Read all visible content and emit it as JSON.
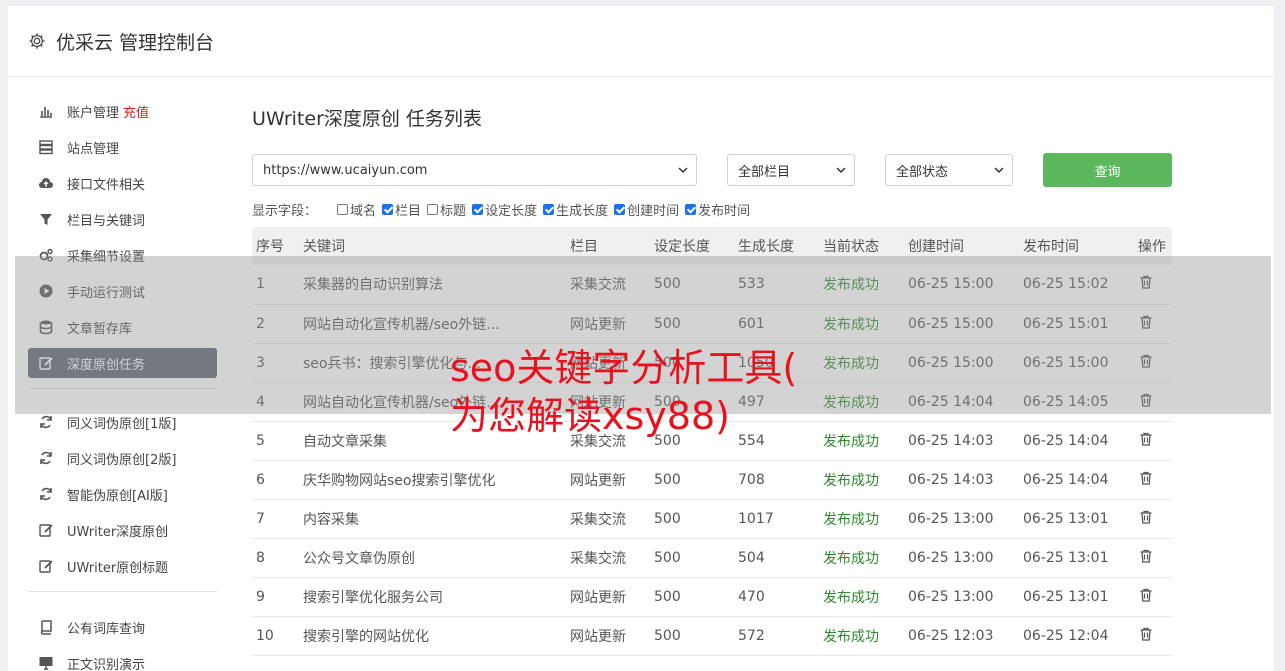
{
  "header": {
    "title": "优采云 管理控制台"
  },
  "sidebar": {
    "group1": [
      {
        "label": "账户管理",
        "accent": "充值",
        "icon": "bar-chart-icon"
      },
      {
        "label": "站点管理",
        "icon": "server-icon"
      },
      {
        "label": "接口文件相关",
        "icon": "cloud-upload-icon"
      },
      {
        "label": "栏目与关键词",
        "icon": "filter-icon"
      },
      {
        "label": "采集细节设置",
        "icon": "gears-icon"
      },
      {
        "label": "手动运行测试",
        "icon": "play-icon"
      },
      {
        "label": "文章暂存库",
        "icon": "database-icon"
      },
      {
        "label": "深度原创任务",
        "icon": "edit-icon",
        "active": true
      }
    ],
    "group2": [
      {
        "label": "同义词伪原创[1版]",
        "icon": "refresh-icon"
      },
      {
        "label": "同义词伪原创[2版]",
        "icon": "refresh-icon"
      },
      {
        "label": "智能伪原创[AI版]",
        "icon": "refresh-icon"
      },
      {
        "label": "UWriter深度原创",
        "icon": "edit-icon"
      },
      {
        "label": "UWriter原创标题",
        "icon": "edit-icon"
      }
    ],
    "group3": [
      {
        "label": "公有词库查询",
        "icon": "book-icon"
      },
      {
        "label": "正文识别演示",
        "icon": "monitor-icon"
      }
    ]
  },
  "main": {
    "title": "UWriter深度原创 任务列表",
    "filters": {
      "site": "https://www.ucaiyun.com",
      "category": "全部栏目",
      "status": "全部状态",
      "query_label": "查询"
    },
    "fields_label": "显示字段：",
    "fields": [
      {
        "label": "域名",
        "checked": false
      },
      {
        "label": "栏目",
        "checked": true
      },
      {
        "label": "标题",
        "checked": false
      },
      {
        "label": "设定长度",
        "checked": true
      },
      {
        "label": "生成长度",
        "checked": true
      },
      {
        "label": "创建时间",
        "checked": true
      },
      {
        "label": "发布时间",
        "checked": true
      }
    ],
    "table": {
      "headers": [
        "序号",
        "关键词",
        "栏目",
        "设定长度",
        "生成长度",
        "当前状态",
        "创建时间",
        "发布时间",
        "操作"
      ],
      "rows": [
        {
          "no": "1",
          "keyword": "采集器的自动识别算法",
          "category": "采集交流",
          "set_len": "500",
          "gen_len": "533",
          "status": "发布成功",
          "created": "06-25 15:00",
          "published": "06-25 15:02"
        },
        {
          "no": "2",
          "keyword": "网站自动化宣传机器/seo外链...",
          "category": "网站更新",
          "set_len": "500",
          "gen_len": "601",
          "status": "发布成功",
          "created": "06-25 15:00",
          "published": "06-25 15:01"
        },
        {
          "no": "3",
          "keyword": "seo兵书：搜索引擎优化与...",
          "category": "网站更新",
          "set_len": "500",
          "gen_len": "1050",
          "status": "发布成功",
          "created": "06-25 15:00",
          "published": "06-25 15:00"
        },
        {
          "no": "4",
          "keyword": "网站自动化宣传机器/seo外链...",
          "category": "网站更新",
          "set_len": "500",
          "gen_len": "497",
          "status": "发布成功",
          "created": "06-25 14:04",
          "published": "06-25 14:05"
        },
        {
          "no": "5",
          "keyword": "自动文章采集",
          "category": "采集交流",
          "set_len": "500",
          "gen_len": "554",
          "status": "发布成功",
          "created": "06-25 14:03",
          "published": "06-25 14:04"
        },
        {
          "no": "6",
          "keyword": "庆华购物网站seo搜索引擎优化",
          "category": "网站更新",
          "set_len": "500",
          "gen_len": "708",
          "status": "发布成功",
          "created": "06-25 14:03",
          "published": "06-25 14:04"
        },
        {
          "no": "7",
          "keyword": "内容采集",
          "category": "采集交流",
          "set_len": "500",
          "gen_len": "1017",
          "status": "发布成功",
          "created": "06-25 13:00",
          "published": "06-25 13:01"
        },
        {
          "no": "8",
          "keyword": "公众号文章伪原创",
          "category": "采集交流",
          "set_len": "500",
          "gen_len": "504",
          "status": "发布成功",
          "created": "06-25 13:00",
          "published": "06-25 13:01"
        },
        {
          "no": "9",
          "keyword": "搜索引擎优化服务公司",
          "category": "网站更新",
          "set_len": "500",
          "gen_len": "470",
          "status": "发布成功",
          "created": "06-25 13:00",
          "published": "06-25 13:01"
        },
        {
          "no": "10",
          "keyword": "搜索引擎的网站优化",
          "category": "网站更新",
          "set_len": "500",
          "gen_len": "572",
          "status": "发布成功",
          "created": "06-25 12:03",
          "published": "06-25 12:04"
        }
      ]
    }
  },
  "watermark": {
    "line1": "seo关键字分析工具(",
    "line2": "为您解读xsy88)"
  },
  "colors": {
    "accent_green": "#5cb85c",
    "status_green": "#2d8a2d",
    "active_nav": "#5a6272",
    "accent_red": "#e02020",
    "watermark_red": "#e8121e"
  }
}
